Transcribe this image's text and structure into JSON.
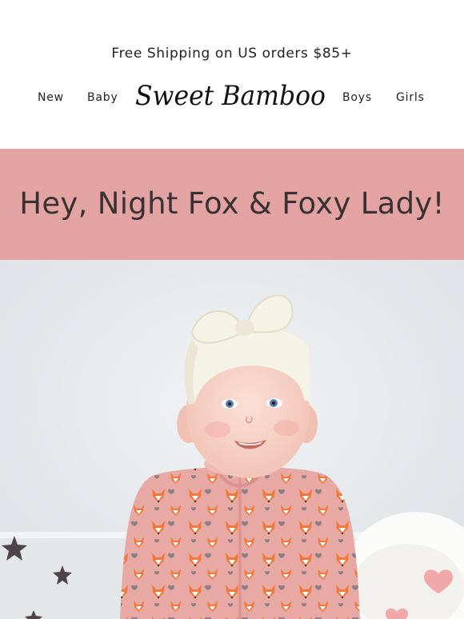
{
  "header": {
    "promo": "Free Shipping on US orders $85+",
    "logo_text": "Sweet Bamboo",
    "nav": {
      "new": "New",
      "baby": "Baby",
      "boys": "Boys",
      "girls": "Girls"
    }
  },
  "banner": {
    "headline": "Hey, Night Fox & Foxy Lady!",
    "background": "#e3a3a3"
  },
  "hero": {
    "image": "baby-in-fox-print-pajamas",
    "colors": {
      "wall": "#e9ecef",
      "pajama": "#e8a8a3",
      "bow": "#f5f2e6",
      "stars": "#4e4447",
      "hearts": "#f0a8a8"
    }
  }
}
